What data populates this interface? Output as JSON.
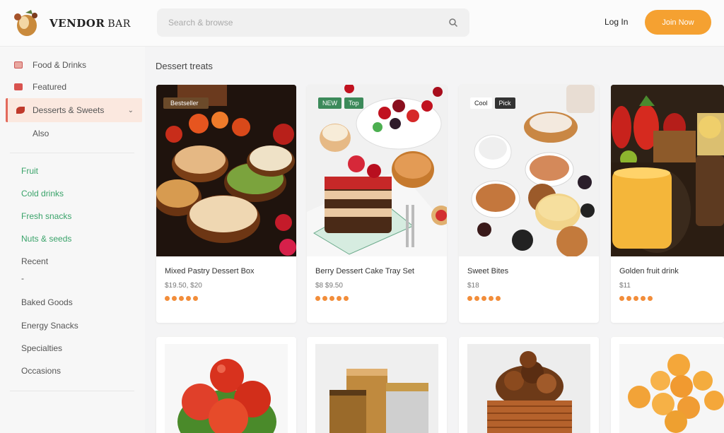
{
  "header": {
    "logo_text": "VENDOR",
    "logo_sub": "BAR",
    "search_placeholder": "Search & browse",
    "login": "Log In",
    "cta": "Join Now"
  },
  "sidebar": {
    "items": [
      {
        "label": "Food & Drinks",
        "icon": "folder-icon"
      },
      {
        "label": "Featured",
        "icon": "star-icon"
      },
      {
        "label": "Desserts & Sweets",
        "icon": "leaf-icon"
      },
      {
        "label": "Also",
        "icon": ""
      }
    ],
    "green_items": [
      "Fruit",
      "Cold drinks",
      "Fresh snacks",
      "Nuts & seeds"
    ],
    "more_items": [
      "Recent",
      "-",
      "Baked Goods",
      "Energy Snacks",
      "Specialties",
      "Occasions"
    ]
  },
  "main": {
    "section_title": "Dessert treats",
    "cards": [
      {
        "title": "Mixed Pastry Dessert Box",
        "price": "$19.50, $20",
        "badge": "Bestseller",
        "badge_color": "#6b4a2a"
      },
      {
        "title": "Berry Dessert Cake Tray Set",
        "price": "$8 $9.50",
        "badge": "NEW",
        "badge2": "Top",
        "badge_color": "#3c8a5a"
      },
      {
        "title": "Sweet Bites",
        "price": "$18",
        "badge": "Cool",
        "badge2": "Pick",
        "badge_color": "#ffffff"
      },
      {
        "title": "Golden fruit drink",
        "price": "$11",
        "badge": "",
        "badge_color": "#ffffff"
      }
    ],
    "rating": 5,
    "colors": {
      "accent": "#f5a131",
      "star": "#f28d3a",
      "active_border": "#e36a5c",
      "active_bg": "#fbe8df",
      "green": "#3aa36a"
    }
  }
}
